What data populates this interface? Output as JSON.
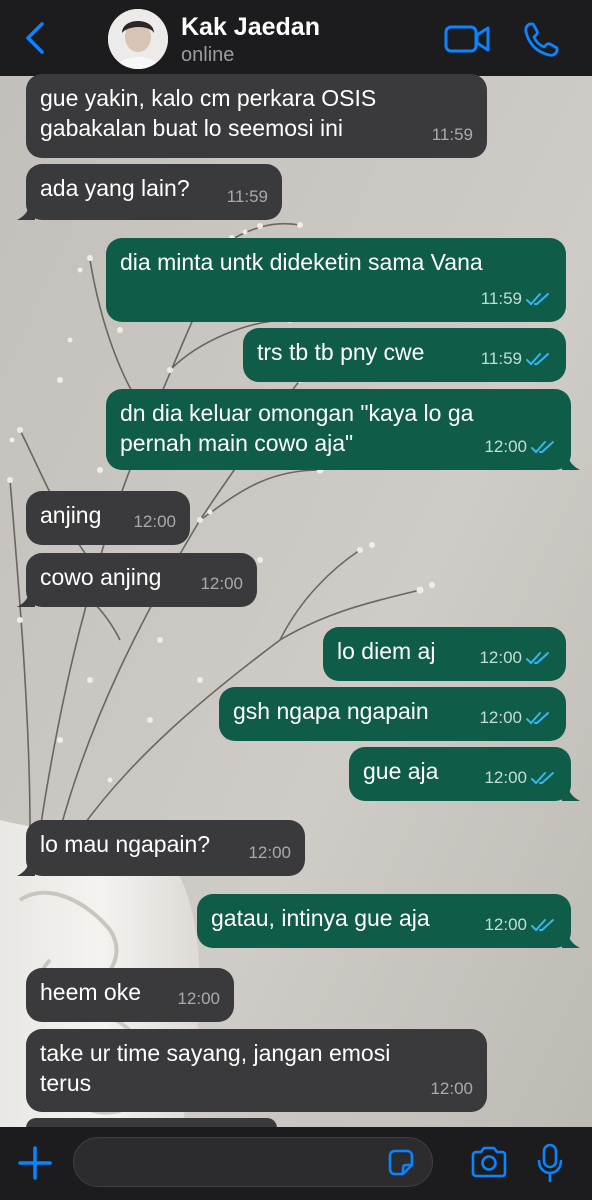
{
  "header": {
    "contact_name": "Kak Jaedan",
    "status": "online"
  },
  "colors": {
    "incoming_bubble": "#3a3a3c",
    "outgoing_bubble": "#0f5c48",
    "accent": "#0a84ff",
    "read_ticks": "#34b7f1"
  },
  "icons": [
    "chevron-left-icon",
    "video-camera-icon",
    "phone-icon",
    "plus-icon",
    "sticker-icon",
    "camera-icon",
    "microphone-icon",
    "double-check-icon"
  ],
  "messages": [
    {
      "dir": "in",
      "text": "gue yakin, kalo cm perkara OSIS\ngabakalan buat lo seemosi ini",
      "time": "11:59"
    },
    {
      "dir": "in",
      "text": "ada yang lain?",
      "time": "11:59"
    },
    {
      "dir": "out",
      "text": "dia minta untk dideketin sama Vana",
      "time": "11:59",
      "read": true
    },
    {
      "dir": "out",
      "text": "trs tb tb pny cwe",
      "time": "11:59",
      "read": true
    },
    {
      "dir": "out",
      "text": "dn dia keluar omongan \"kaya lo ga\npernah main cowo aja\"",
      "time": "12:00",
      "read": true
    },
    {
      "dir": "in",
      "text": "anjing",
      "time": "12:00"
    },
    {
      "dir": "in",
      "text": "cowo anjing",
      "time": "12:00"
    },
    {
      "dir": "out",
      "text": "lo diem aj",
      "time": "12:00",
      "read": true
    },
    {
      "dir": "out",
      "text": "gsh ngapa ngapain",
      "time": "12:00",
      "read": true
    },
    {
      "dir": "out",
      "text": "gue aja",
      "time": "12:00",
      "read": true
    },
    {
      "dir": "in",
      "text": "lo mau ngapain?",
      "time": "12:00"
    },
    {
      "dir": "out",
      "text": "gatau, intinya gue aja",
      "time": "12:00",
      "read": true
    },
    {
      "dir": "in",
      "text": "heem oke",
      "time": "12:00"
    },
    {
      "dir": "in",
      "text": "take ur time sayang, jangan emosi\nterus",
      "time": "12:00"
    }
  ],
  "composer": {
    "value": "",
    "placeholder": ""
  }
}
